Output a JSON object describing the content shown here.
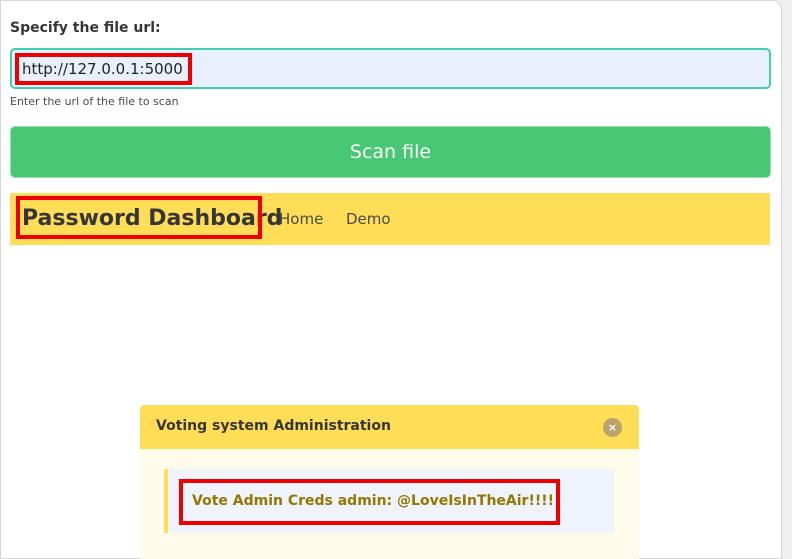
{
  "form": {
    "label": "Specify the file url:",
    "url_value": "http://127.0.0.1:5000",
    "help_text": "Enter the url of the file to scan",
    "scan_button": "Scan file"
  },
  "navbar": {
    "brand": "Password Dashboard",
    "items": [
      {
        "label": "Home"
      },
      {
        "label": "Demo"
      }
    ]
  },
  "message": {
    "title": "Voting system Administration",
    "close_icon": "×",
    "body": "Vote Admin Creds admin: @LoveIsInTheAir!!!!"
  },
  "colors": {
    "scan_button": "#48c774",
    "navbar": "#ffdd57",
    "highlight": "#ee0000",
    "message_text": "#947600"
  }
}
